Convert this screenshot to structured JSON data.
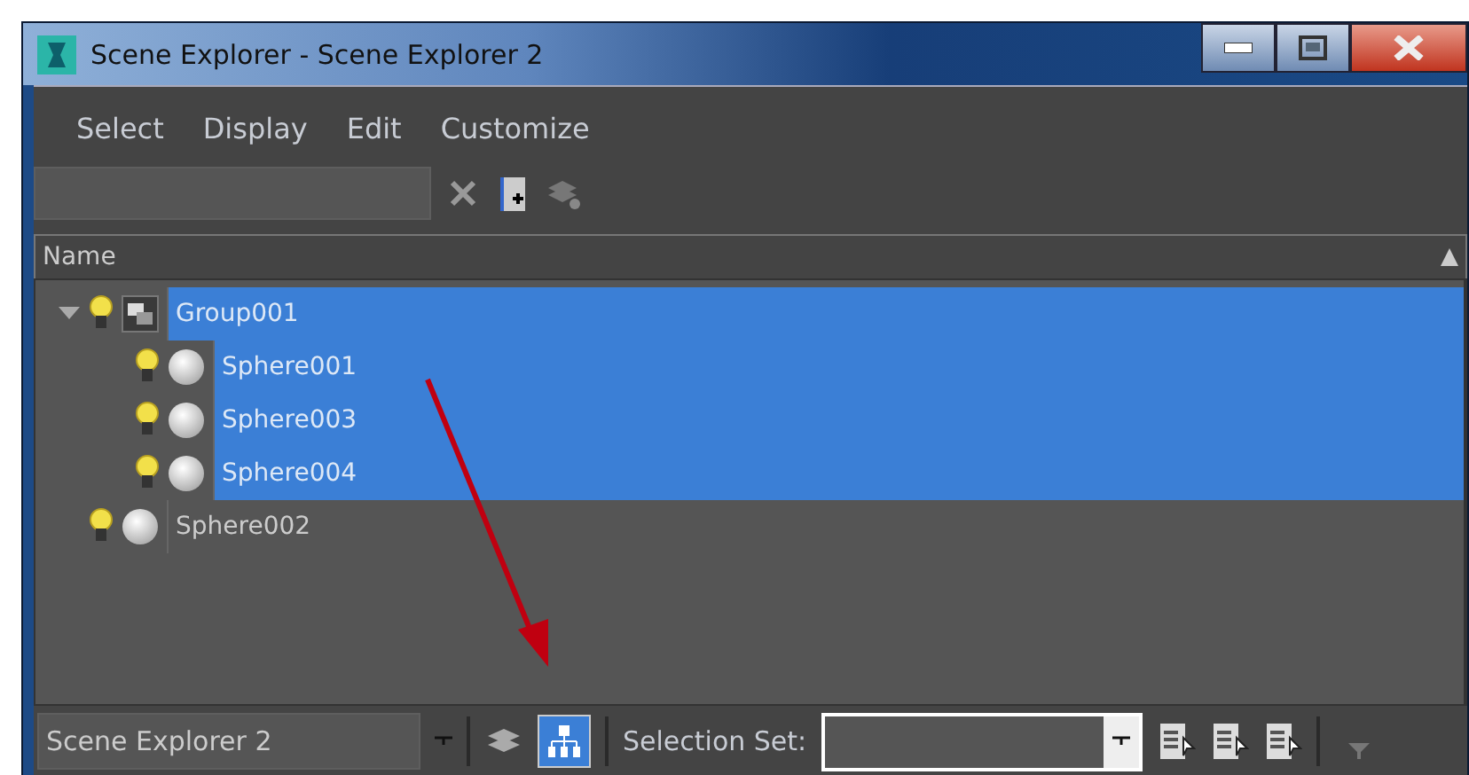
{
  "window": {
    "title": "Scene Explorer - Scene Explorer 2"
  },
  "menu": [
    "Select",
    "Display",
    "Edit",
    "Customize"
  ],
  "column": {
    "label": "Name"
  },
  "tree": [
    {
      "kind": "group",
      "label": "Group001",
      "selected": true,
      "expanded": true,
      "children": [
        {
          "kind": "object",
          "label": "Sphere001",
          "selected": true
        },
        {
          "kind": "object",
          "label": "Sphere003",
          "selected": true
        },
        {
          "kind": "object",
          "label": "Sphere004",
          "selected": true
        }
      ]
    },
    {
      "kind": "object",
      "label": "Sphere002",
      "selected": false
    }
  ],
  "bottom": {
    "explorer": "Scene Explorer 2",
    "hierarchy_on": true,
    "selection_label": "Selection Set:"
  }
}
